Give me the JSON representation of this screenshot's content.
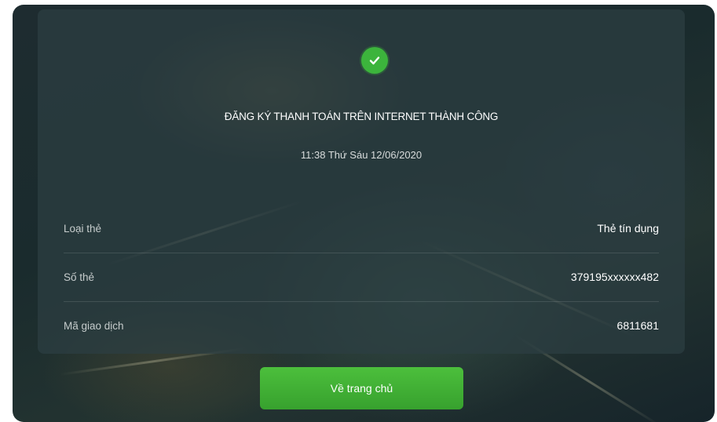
{
  "result": {
    "title": "ĐĂNG KÝ THANH TOÁN TRÊN INTERNET THÀNH CÔNG",
    "datetime": "11:38 Thứ Sáu 12/06/2020",
    "status_icon": "check-icon",
    "status_color": "#3cb43c"
  },
  "details": [
    {
      "label": "Loại thẻ",
      "value": "Thẻ tín dụng"
    },
    {
      "label": "Số thẻ",
      "value": "379195xxxxxx482"
    },
    {
      "label": "Mã giao dịch",
      "value": "6811681"
    }
  ],
  "actions": {
    "home_label": "Về trang chủ"
  }
}
